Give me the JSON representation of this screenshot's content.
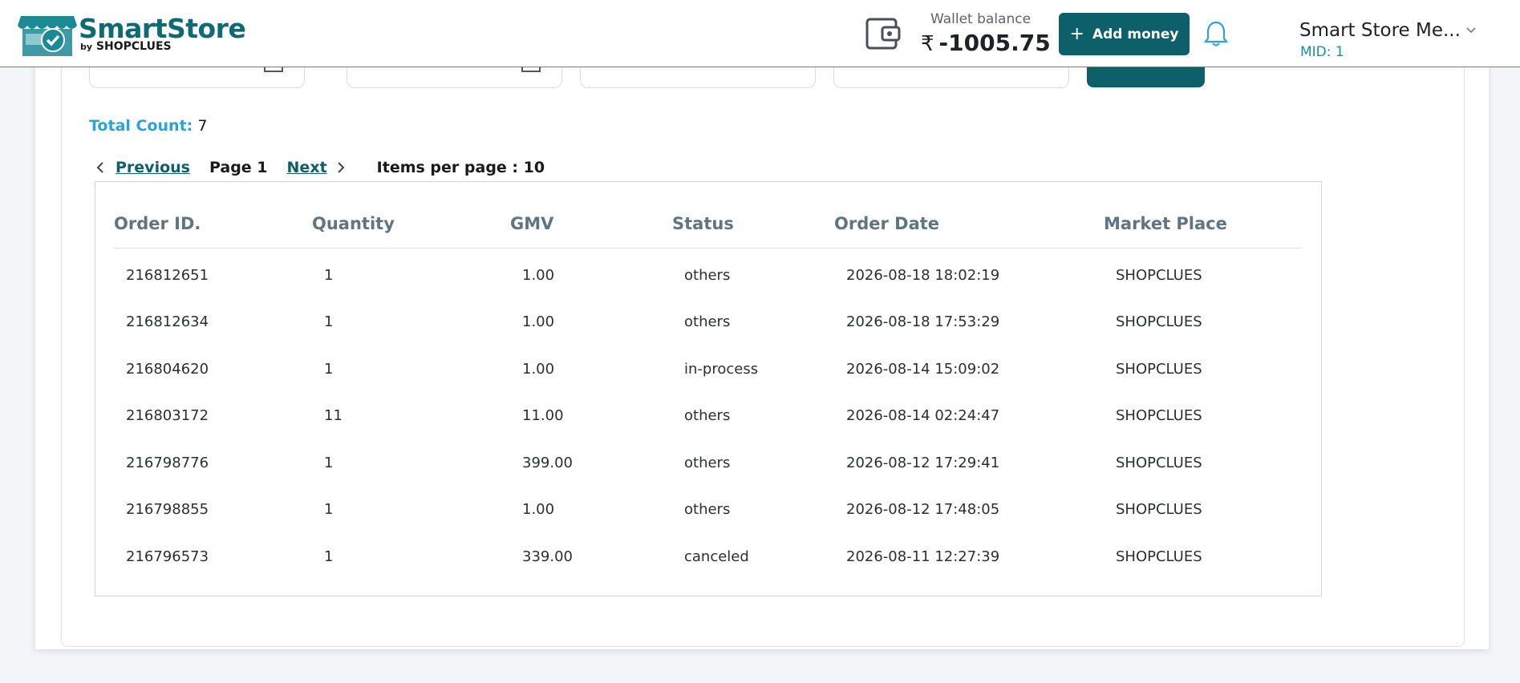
{
  "header": {
    "logo_title": "SmartStore",
    "logo_by": "by",
    "logo_brand": "SHOPCLUES",
    "wallet_label": "Wallet balance",
    "wallet_currency": "₹",
    "wallet_amount": "-1005.75",
    "add_money_plus": "+",
    "add_money_label": "Add money",
    "store_name": "Smart Store Me...",
    "mid": "MID: 1"
  },
  "summary": {
    "total_label": "Total Count:",
    "total_value": "7"
  },
  "pager": {
    "previous": "Previous",
    "current": "Page 1",
    "next": "Next",
    "items_per_page": "Items per page : 10"
  },
  "table": {
    "columns": [
      "Order ID.",
      "Quantity",
      "GMV",
      "Status",
      "Order Date",
      "Market Place"
    ],
    "rows": [
      [
        "216812651",
        "1",
        "1.00",
        "others",
        "2026-08-18 18:02:19",
        "SHOPCLUES"
      ],
      [
        "216812634",
        "1",
        "1.00",
        "others",
        "2026-08-18 17:53:29",
        "SHOPCLUES"
      ],
      [
        "216804620",
        "1",
        "1.00",
        "in-process",
        "2026-08-14 15:09:02",
        "SHOPCLUES"
      ],
      [
        "216803172",
        "11",
        "11.00",
        "others",
        "2026-08-14 02:24:47",
        "SHOPCLUES"
      ],
      [
        "216798776",
        "1",
        "399.00",
        "others",
        "2026-08-12 17:29:41",
        "SHOPCLUES"
      ],
      [
        "216798855",
        "1",
        "1.00",
        "others",
        "2026-08-12 17:48:05",
        "SHOPCLUES"
      ],
      [
        "216796573",
        "1",
        "339.00",
        "canceled",
        "2026-08-11 12:27:39",
        "SHOPCLUES"
      ]
    ]
  },
  "icons": {
    "wallet": "wallet-icon",
    "bell": "bell-icon",
    "caret": "chevron-down-icon",
    "calendar": "calendar-icon",
    "prev": "chevron-left-icon",
    "next": "chevron-right-icon"
  },
  "colors": {
    "brand": "#0d5f69",
    "accent": "#2aa4d8",
    "mid": "#1b8fa0"
  }
}
